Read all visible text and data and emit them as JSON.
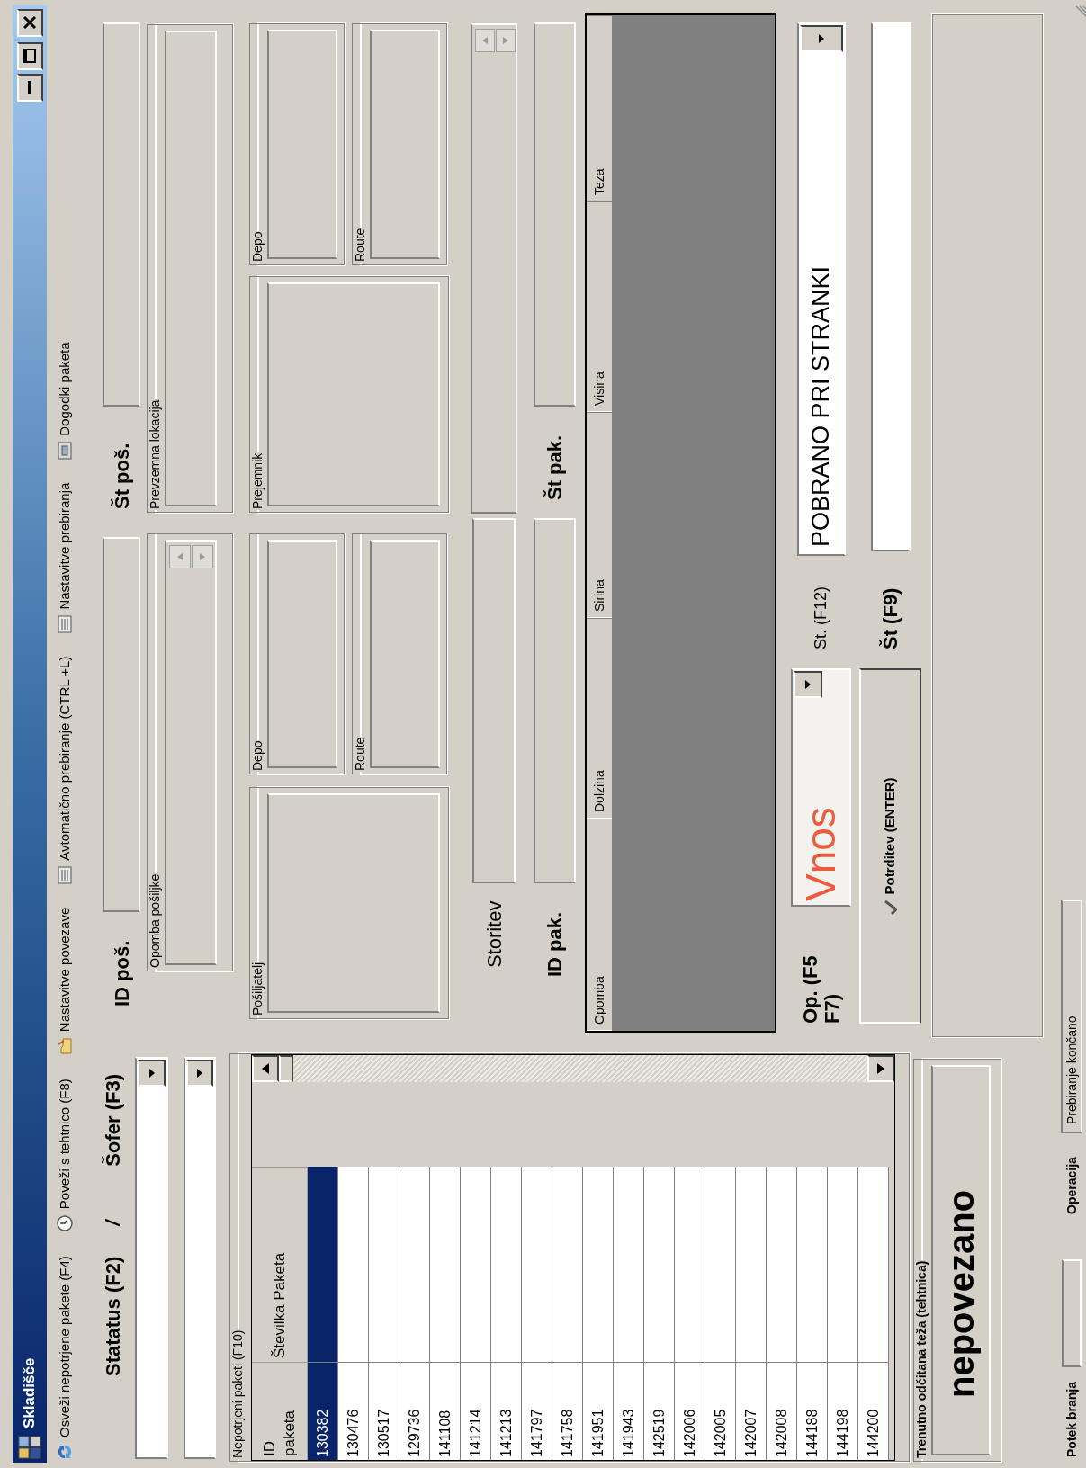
{
  "window": {
    "title": "Skladišče"
  },
  "toolbar": [
    {
      "label": "Osveži nepotrjene pakete (F4)"
    },
    {
      "label": "Poveži s tehtnico (F8)"
    },
    {
      "label": "Nastavitve povezave"
    },
    {
      "label": "Avtomatično prebiranje (CTRL +L)"
    },
    {
      "label": "Nastavitve prebiranja"
    },
    {
      "label": "Dogodki paketa"
    }
  ],
  "filters": {
    "status_label": "Statatus (F2)",
    "separator": "/",
    "driver_label": "Šofer (F3)"
  },
  "unconfirmed": {
    "title": "Nepotrjeni paketi (F10)",
    "columns": [
      "ID paketa",
      "Številka Paketa"
    ],
    "rows": [
      {
        "id": "130382",
        "selected": true
      },
      {
        "id": "130476",
        "selected": false
      },
      {
        "id": "130517",
        "selected": false
      },
      {
        "id": "129736",
        "selected": false
      },
      {
        "id": "141108",
        "selected": false
      },
      {
        "id": "141214",
        "selected": false
      },
      {
        "id": "141213",
        "selected": false
      },
      {
        "id": "141797",
        "selected": false
      },
      {
        "id": "141758",
        "selected": false
      },
      {
        "id": "141951",
        "selected": false
      },
      {
        "id": "141943",
        "selected": false
      },
      {
        "id": "142519",
        "selected": false
      },
      {
        "id": "142006",
        "selected": false
      },
      {
        "id": "142005",
        "selected": false
      },
      {
        "id": "142007",
        "selected": false
      },
      {
        "id": "142008",
        "selected": false
      },
      {
        "id": "144188",
        "selected": false
      },
      {
        "id": "144198",
        "selected": false
      },
      {
        "id": "144200",
        "selected": false
      }
    ]
  },
  "weight": {
    "title": "Trenutno odčitana teža (tehtnica)",
    "value": "nepovezano"
  },
  "shipment": {
    "id_label": "ID poš.",
    "number_label": "Št poš.",
    "note_group": "Opomba pošiljke",
    "pickup_group": "Prevzemna lokacija",
    "parties": [
      {
        "title": "Pošiljatelj",
        "depo": "Depo",
        "route": "Route"
      },
      {
        "title": "Prejemnik",
        "depo": "Depo",
        "route": "Route"
      }
    ]
  },
  "package": {
    "service_label": "Storitev",
    "id_label": "ID pak.",
    "number_label": "Št pak.",
    "columns": [
      "Opomba",
      "Dolzina",
      "Sirina",
      "Visina",
      "Teza"
    ]
  },
  "operation": {
    "op_label": "Op. (F5 F7)",
    "op_value": "Vnos",
    "status_label": "St. (F12)",
    "status_value": "POBRANO PRI STRANKI",
    "confirm": "Potrditev (ENTER)",
    "number_label": "Št (F9)"
  },
  "status_bar": {
    "progress_label": "Potek branja",
    "operation_label": "Operacija",
    "operation_value": "Prebiranje končano"
  }
}
